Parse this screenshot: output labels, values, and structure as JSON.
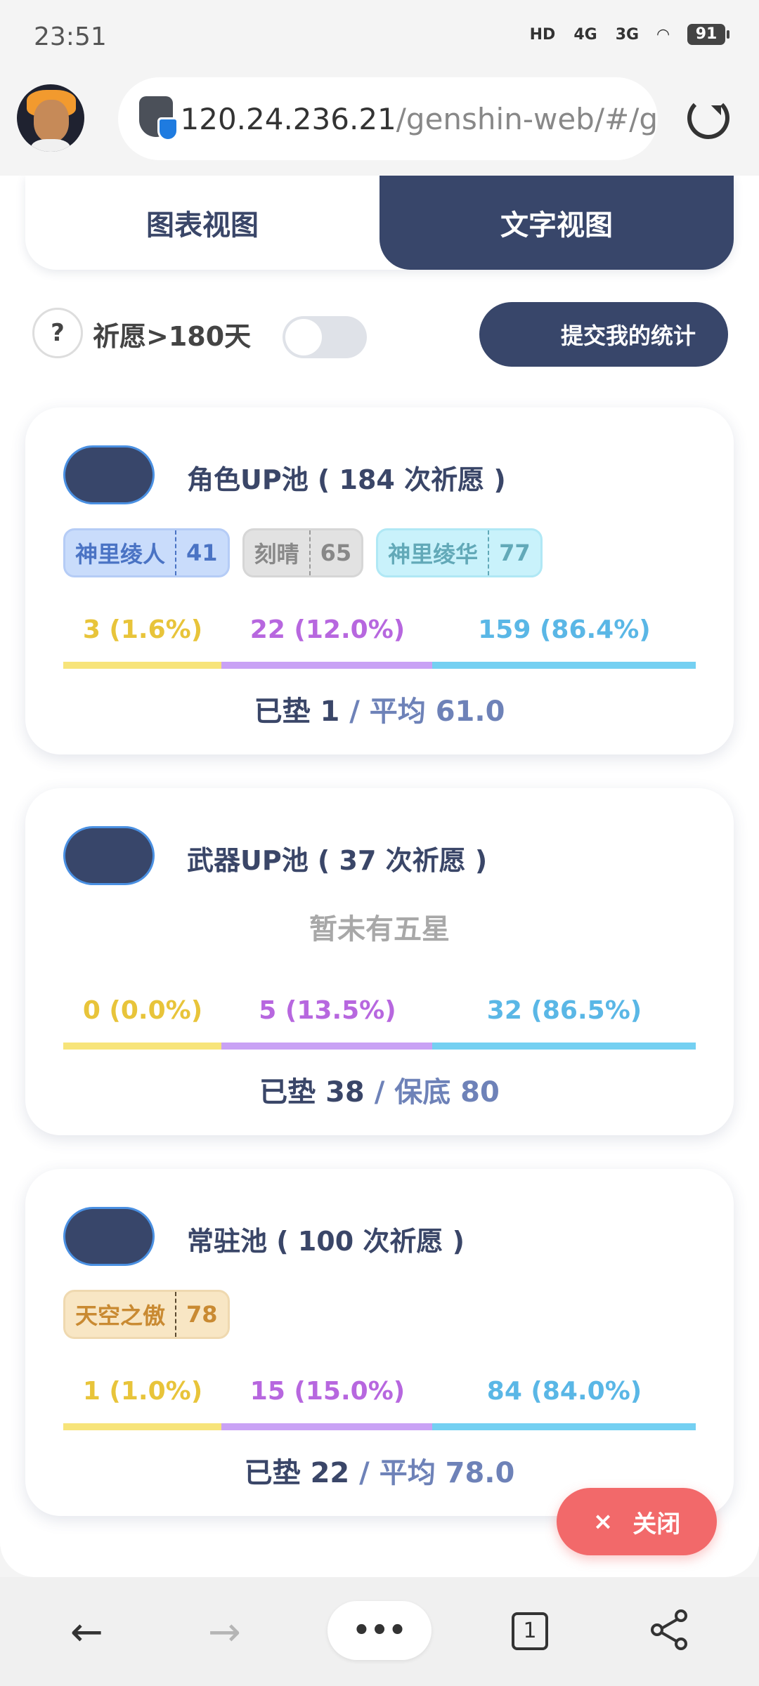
{
  "status_bar": {
    "time": "23:51",
    "hd": "HD",
    "net1": "4G",
    "net2": "3G",
    "battery": "91"
  },
  "browser": {
    "url_main": "120.24.236.21",
    "url_path": "/genshin-web/#/g"
  },
  "tabs": {
    "chart_view": "图表视图",
    "text_view": "文字视图"
  },
  "controls": {
    "help": "?",
    "filter_label": "祈愿>180天",
    "submit_button": "提交我的统计"
  },
  "cards": [
    {
      "title": "角色UP池 ( 184 次祈愿 )",
      "chips": [
        {
          "name": "神里绫人",
          "value": "41"
        },
        {
          "name": "刻晴",
          "value": "65"
        },
        {
          "name": "神里绫华",
          "value": "77"
        }
      ],
      "stats": {
        "five": "3 (1.6%)",
        "four": "22 (12.0%)",
        "three": "159 (86.4%)"
      },
      "footer_main": "已垫 1",
      "footer_sub": " / 平均 61.0"
    },
    {
      "title": "武器UP池 ( 37 次祈愿 )",
      "empty_text": "暂未有五星",
      "stats": {
        "five": "0 (0.0%)",
        "four": "5 (13.5%)",
        "three": "32 (86.5%)"
      },
      "footer_main": "已垫 38",
      "footer_sub": " / 保底 80"
    },
    {
      "title": "常驻池 ( 100 次祈愿 )",
      "chips": [
        {
          "name": "天空之傲",
          "value": "78"
        }
      ],
      "stats": {
        "five": "1 (1.0%)",
        "four": "15 (15.0%)",
        "three": "84 (84.0%)"
      },
      "footer_main": "已垫 22",
      "footer_sub": " / 平均 78.0"
    }
  ],
  "close_button": {
    "icon": "×",
    "label": "关闭"
  },
  "bottom_bar": {
    "back": "←",
    "forward": "→",
    "menu": "•••",
    "tab_count": "1"
  },
  "colors": {
    "primary": "#38466a",
    "five_star": "#e8c43a",
    "four_star": "#b767df",
    "three_star": "#5ab7e6",
    "close": "#f2696a"
  }
}
